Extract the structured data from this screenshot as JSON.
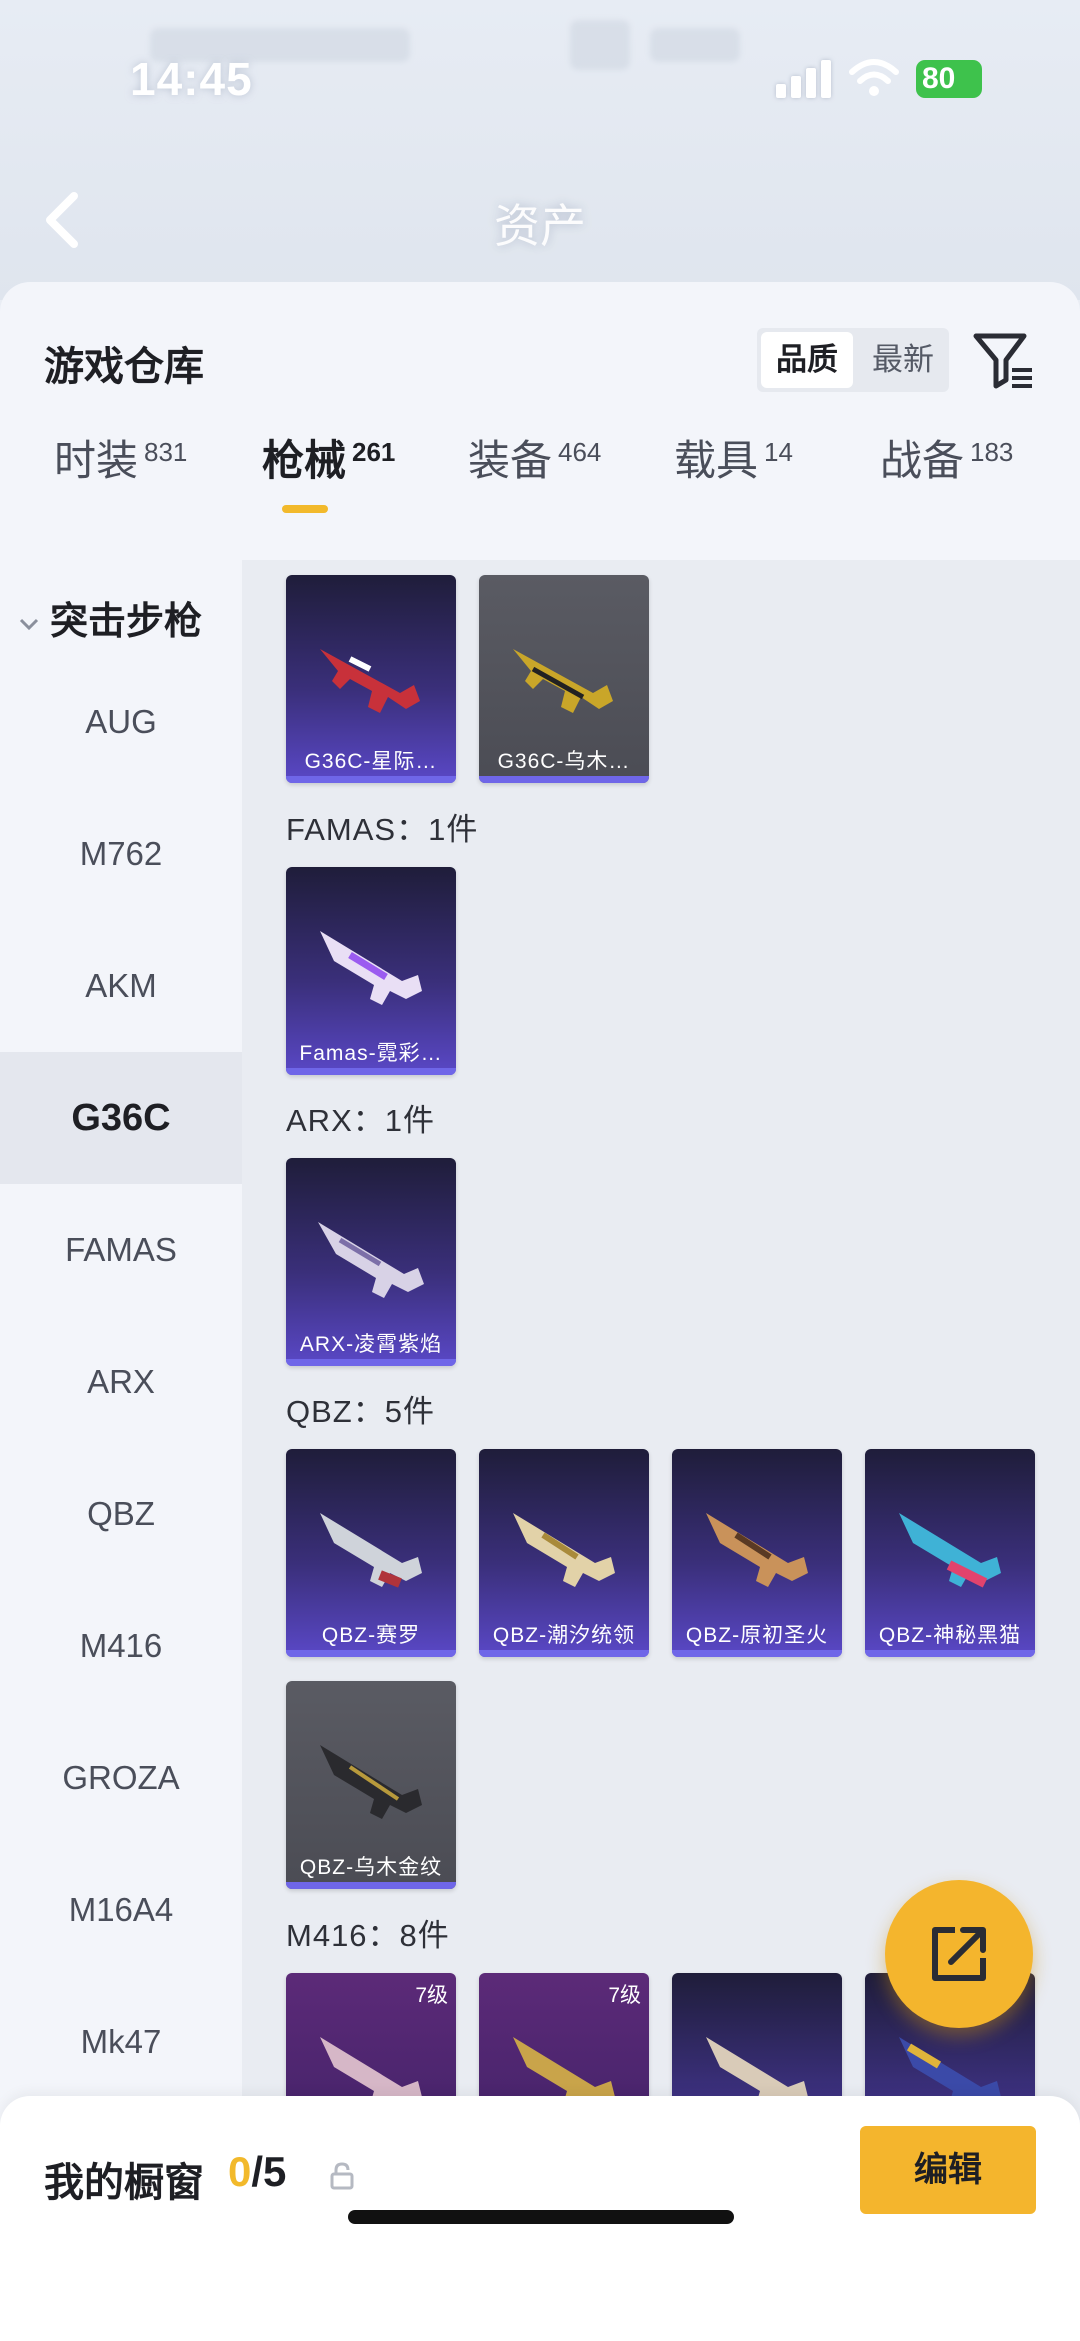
{
  "status_bar": {
    "time": "14:45",
    "battery": "80"
  },
  "header": {
    "title": "资产"
  },
  "sheet": {
    "title": "游戏仓库",
    "sort": {
      "options": [
        "品质",
        "最新"
      ],
      "active": "品质"
    }
  },
  "tabs": [
    {
      "label": "时装",
      "count": "831"
    },
    {
      "label": "枪械",
      "count": "261"
    },
    {
      "label": "装备",
      "count": "464"
    },
    {
      "label": "载具",
      "count": "14"
    },
    {
      "label": "战备",
      "count": "183"
    }
  ],
  "rail": {
    "heading": "突击步枪",
    "items": [
      "AUG",
      "M762",
      "AKM",
      "G36C",
      "FAMAS",
      "ARX",
      "QBZ",
      "M416",
      "GROZA",
      "M16A4",
      "Mk47"
    ],
    "active": "G36C"
  },
  "groups": {
    "g36c": {
      "items": [
        "G36C-星际…",
        "G36C-乌木…"
      ]
    },
    "famas": {
      "title": "FAMAS：1件",
      "items": [
        "Famas-霓彩…"
      ]
    },
    "arx": {
      "title": "ARX：1件",
      "items": [
        "ARX-凌霄紫焰"
      ]
    },
    "qbz": {
      "title": "QBZ：5件",
      "items": [
        "QBZ-赛罗",
        "QBZ-潮汐统领",
        "QBZ-原初圣火",
        "QBZ-神秘黑猫",
        "QBZ-乌木金纹"
      ]
    },
    "m416": {
      "title": "M416：8件",
      "levels": [
        "7级",
        "7级"
      ]
    }
  },
  "bottom_bar": {
    "title": "我的橱窗",
    "count_current": "0",
    "count_total": "/5",
    "edit_label": "编辑"
  },
  "colors": {
    "accent": "#f4b52d",
    "card_purple": "#3a2f7a",
    "card_grey": "#4b4c54"
  }
}
